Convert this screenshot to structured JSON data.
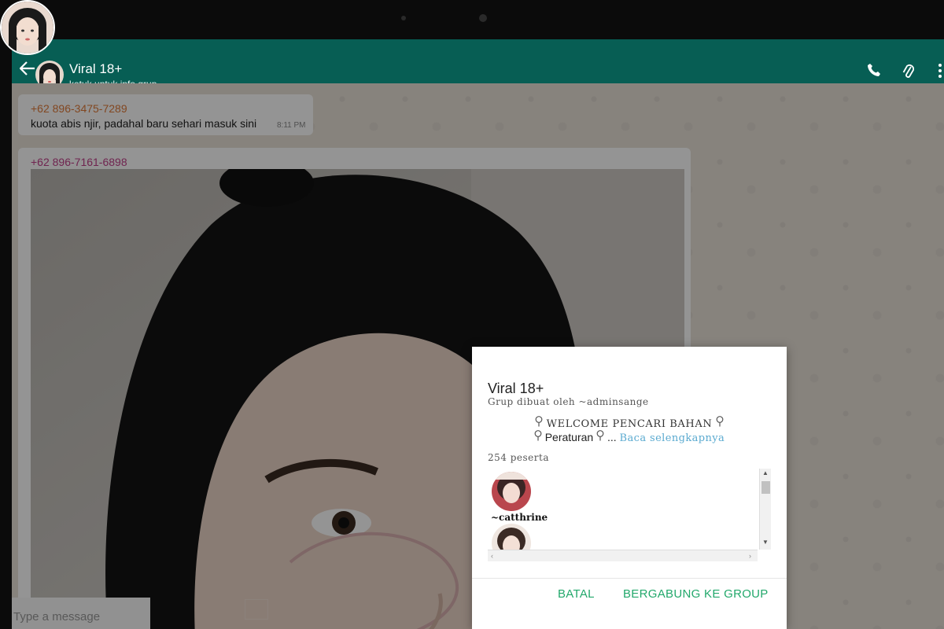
{
  "header": {
    "title": "Viral 18+",
    "subtitle": "ketuk untuk info grup",
    "icons": [
      "back-arrow-icon",
      "phone-icon",
      "paperclip-icon",
      "more-vertical-icon"
    ]
  },
  "messages": [
    {
      "sender": "+62 896-3475-7289",
      "text": "kuota abis njir, padahal baru sehari masuk sini",
      "time": "8:11 PM"
    },
    {
      "sender": "+62 896-7161-6898",
      "content": "image"
    }
  ],
  "input": {
    "placeholder": "Type a message"
  },
  "dialog": {
    "title": "Viral 18+",
    "creator": "Grup dibuat oleh ~adminsange",
    "desc_line1": "WELCOME PENCARI BAHAN",
    "desc_line2": "Peraturan",
    "desc_ellipsis": "...",
    "read_more": "Baca selengkapnya",
    "participant_count": "254 peserta",
    "members": [
      {
        "name": "~catthrine"
      },
      {
        "name": ""
      }
    ],
    "cancel_label": "BATAL",
    "join_label": "BERGABUNG KE GROUP"
  },
  "colors": {
    "appbar": "#075e54",
    "button_text": "#22a86b",
    "read_more": "#5aaad0",
    "sender1": "#e07b39",
    "sender2": "#c2408a"
  }
}
